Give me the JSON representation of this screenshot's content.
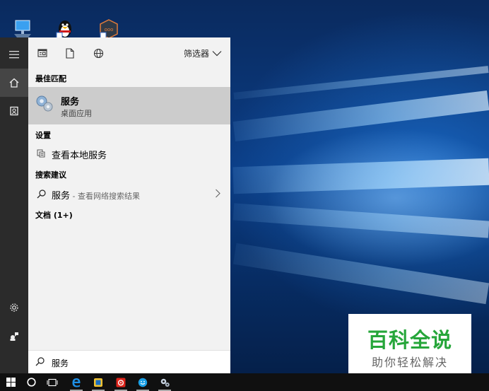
{
  "desktop": {
    "icons": [
      {
        "name": "this-pc",
        "icon": "computer-icon"
      },
      {
        "name": "qq",
        "icon": "penguin-icon"
      },
      {
        "name": "app-shortcut",
        "icon": "app-shortcut-icon"
      }
    ]
  },
  "start_rail": {
    "items": [
      {
        "icon": "hamburger-menu-icon"
      },
      {
        "icon": "home-icon",
        "active": true
      },
      {
        "icon": "notebook-icon"
      },
      {
        "icon": "settings-gear-icon"
      },
      {
        "icon": "feedback-icon"
      }
    ]
  },
  "search_panel": {
    "toolbar": {
      "icons": [
        "apps-filter-icon",
        "documents-filter-icon",
        "web-filter-icon"
      ],
      "filter_label": "筛选器"
    },
    "best_match": {
      "title": "最佳匹配",
      "name": "服务",
      "subtitle": "桌面应用",
      "icon": "services-gears-icon"
    },
    "settings": {
      "title": "设置",
      "item_label": "查看本地服务",
      "item_icon": "local-services-icon"
    },
    "suggestions": {
      "title": "搜索建议",
      "query": "服务",
      "hint": " - 查看网络搜索结果"
    },
    "documents": {
      "title": "文档 (1+)"
    }
  },
  "search_box": {
    "value": "服务"
  },
  "watermark": {
    "title": "百科全说",
    "subtitle": "助你轻松解决"
  },
  "taskbar": {
    "items": [
      {
        "icon": "windows-start-icon"
      },
      {
        "icon": "cortana-circle-icon"
      },
      {
        "icon": "task-view-icon"
      },
      {
        "icon": "edge-browser-icon"
      },
      {
        "icon": "file-manager-icon"
      },
      {
        "icon": "netease-music-icon"
      },
      {
        "icon": "chat-app-icon"
      },
      {
        "icon": "services-app-icon"
      }
    ]
  },
  "colors": {
    "panel_bg": "#f2f2f2",
    "highlight": "#cccccc",
    "rail_bg": "#2b2b2b",
    "watermark_green": "#26a63a"
  }
}
